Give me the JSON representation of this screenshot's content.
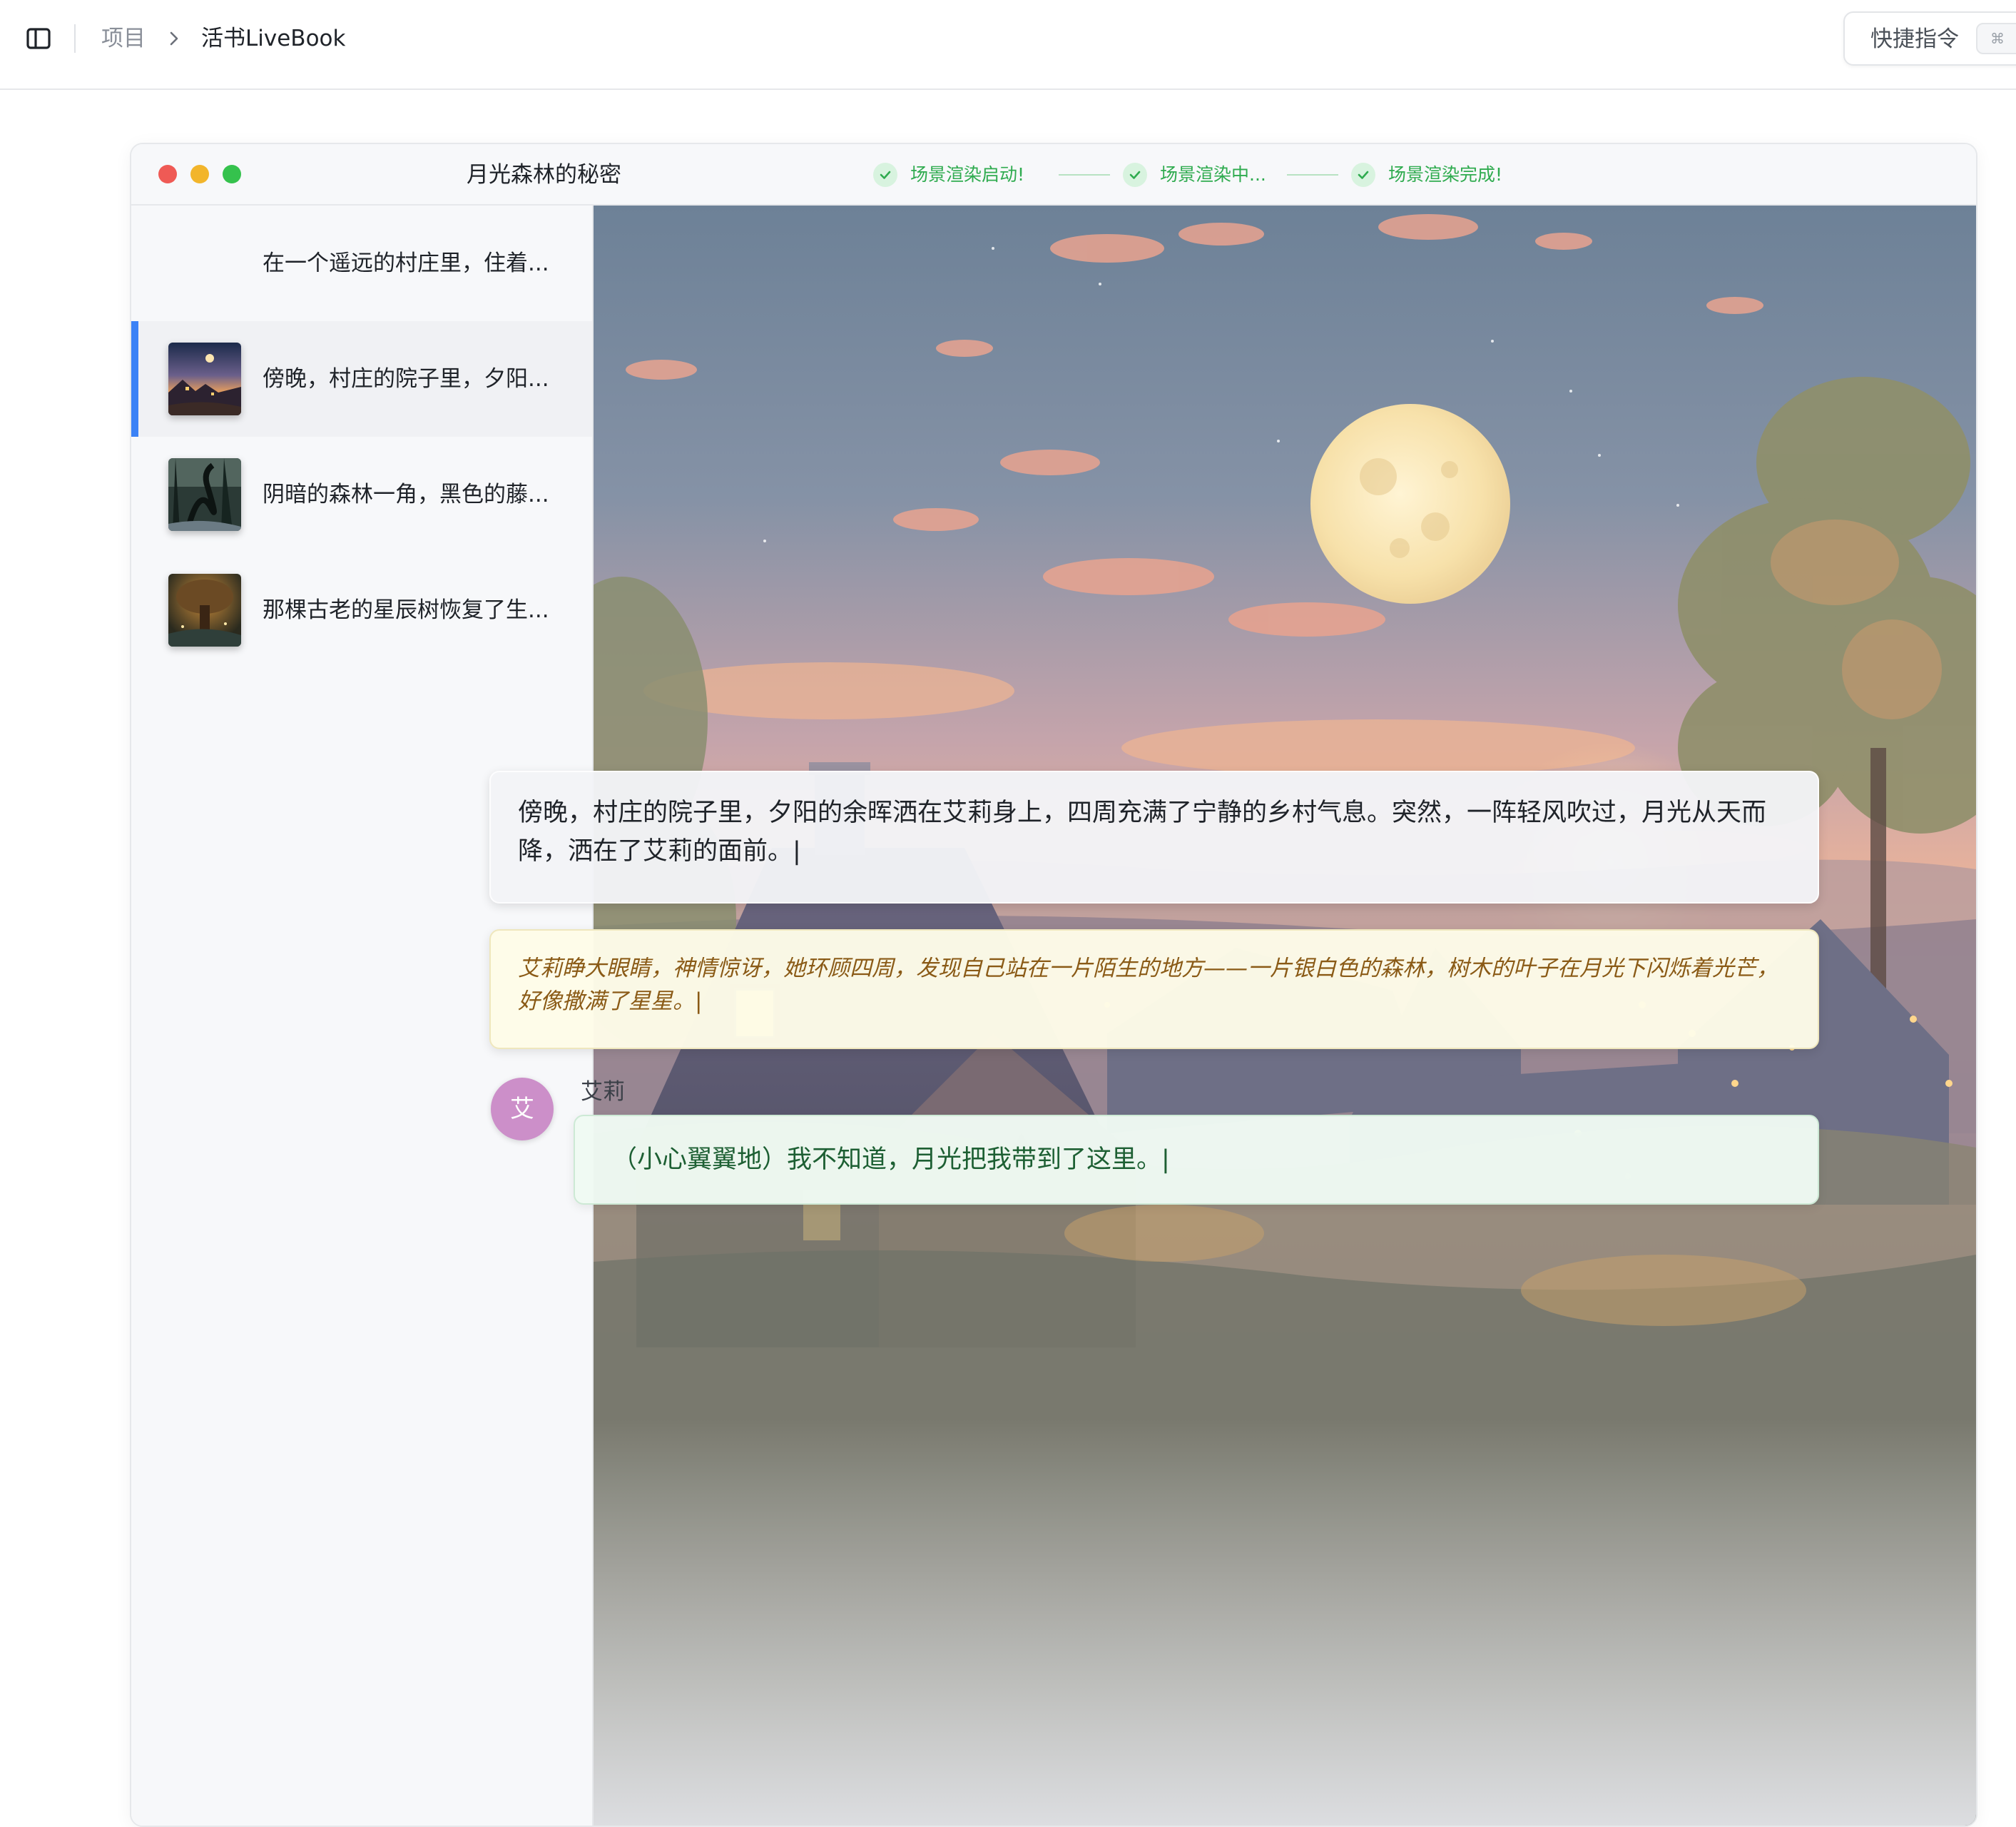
{
  "topbar": {
    "breadcrumb_root": "项目",
    "breadcrumb_current": "活书LiveBook",
    "quick_command_label": "快捷指令",
    "quick_command_shortcut": "⌘"
  },
  "window": {
    "title": "月光森林的秘密",
    "status_steps": [
      {
        "label": "场景渲染启动!"
      },
      {
        "label": "场景渲染中..."
      },
      {
        "label": "场景渲染完成!"
      }
    ]
  },
  "scenes": [
    {
      "text": "在一个遥远的村庄里，住着...",
      "thumbnail": "none"
    },
    {
      "text": "傍晚，村庄的院子里，夕阳...",
      "thumbnail": "village-sunset",
      "active": true
    },
    {
      "text": "阴暗的森林一角，黑色的藤...",
      "thumbnail": "dark-forest-vines"
    },
    {
      "text": "那棵古老的星辰树恢复了生...",
      "thumbnail": "ancient-star-tree"
    }
  ],
  "content": {
    "narration": "傍晚，村庄的院子里，夕阳的余晖洒在艾莉身上，四周充满了宁静的乡村气息。突然，一阵轻风吹过，月光从天而降，洒在了艾莉的面前。|",
    "inner_monologue": "艾莉睁大眼睛，神情惊讶，她环顾四周，发现自己站在一片陌生的地方——一片银白色的森林，树木的叶子在月光下闪烁着光芒，好像撒满了星星。|",
    "speaker": {
      "avatar_char": "艾",
      "name": "艾莉"
    },
    "dialogue": "（小心翼翼地）我不知道，月光把我带到了这里。|"
  },
  "colors": {
    "accent_blue": "#3b82f6",
    "status_green": "#2fab4f",
    "traffic_red": "#ef5a55",
    "traffic_yellow": "#f2b52b",
    "traffic_green": "#35c24d",
    "avatar_pink": "#cc8fc9"
  },
  "icons": [
    "sidebar-toggle-icon",
    "chevron-right-icon",
    "check-icon"
  ]
}
